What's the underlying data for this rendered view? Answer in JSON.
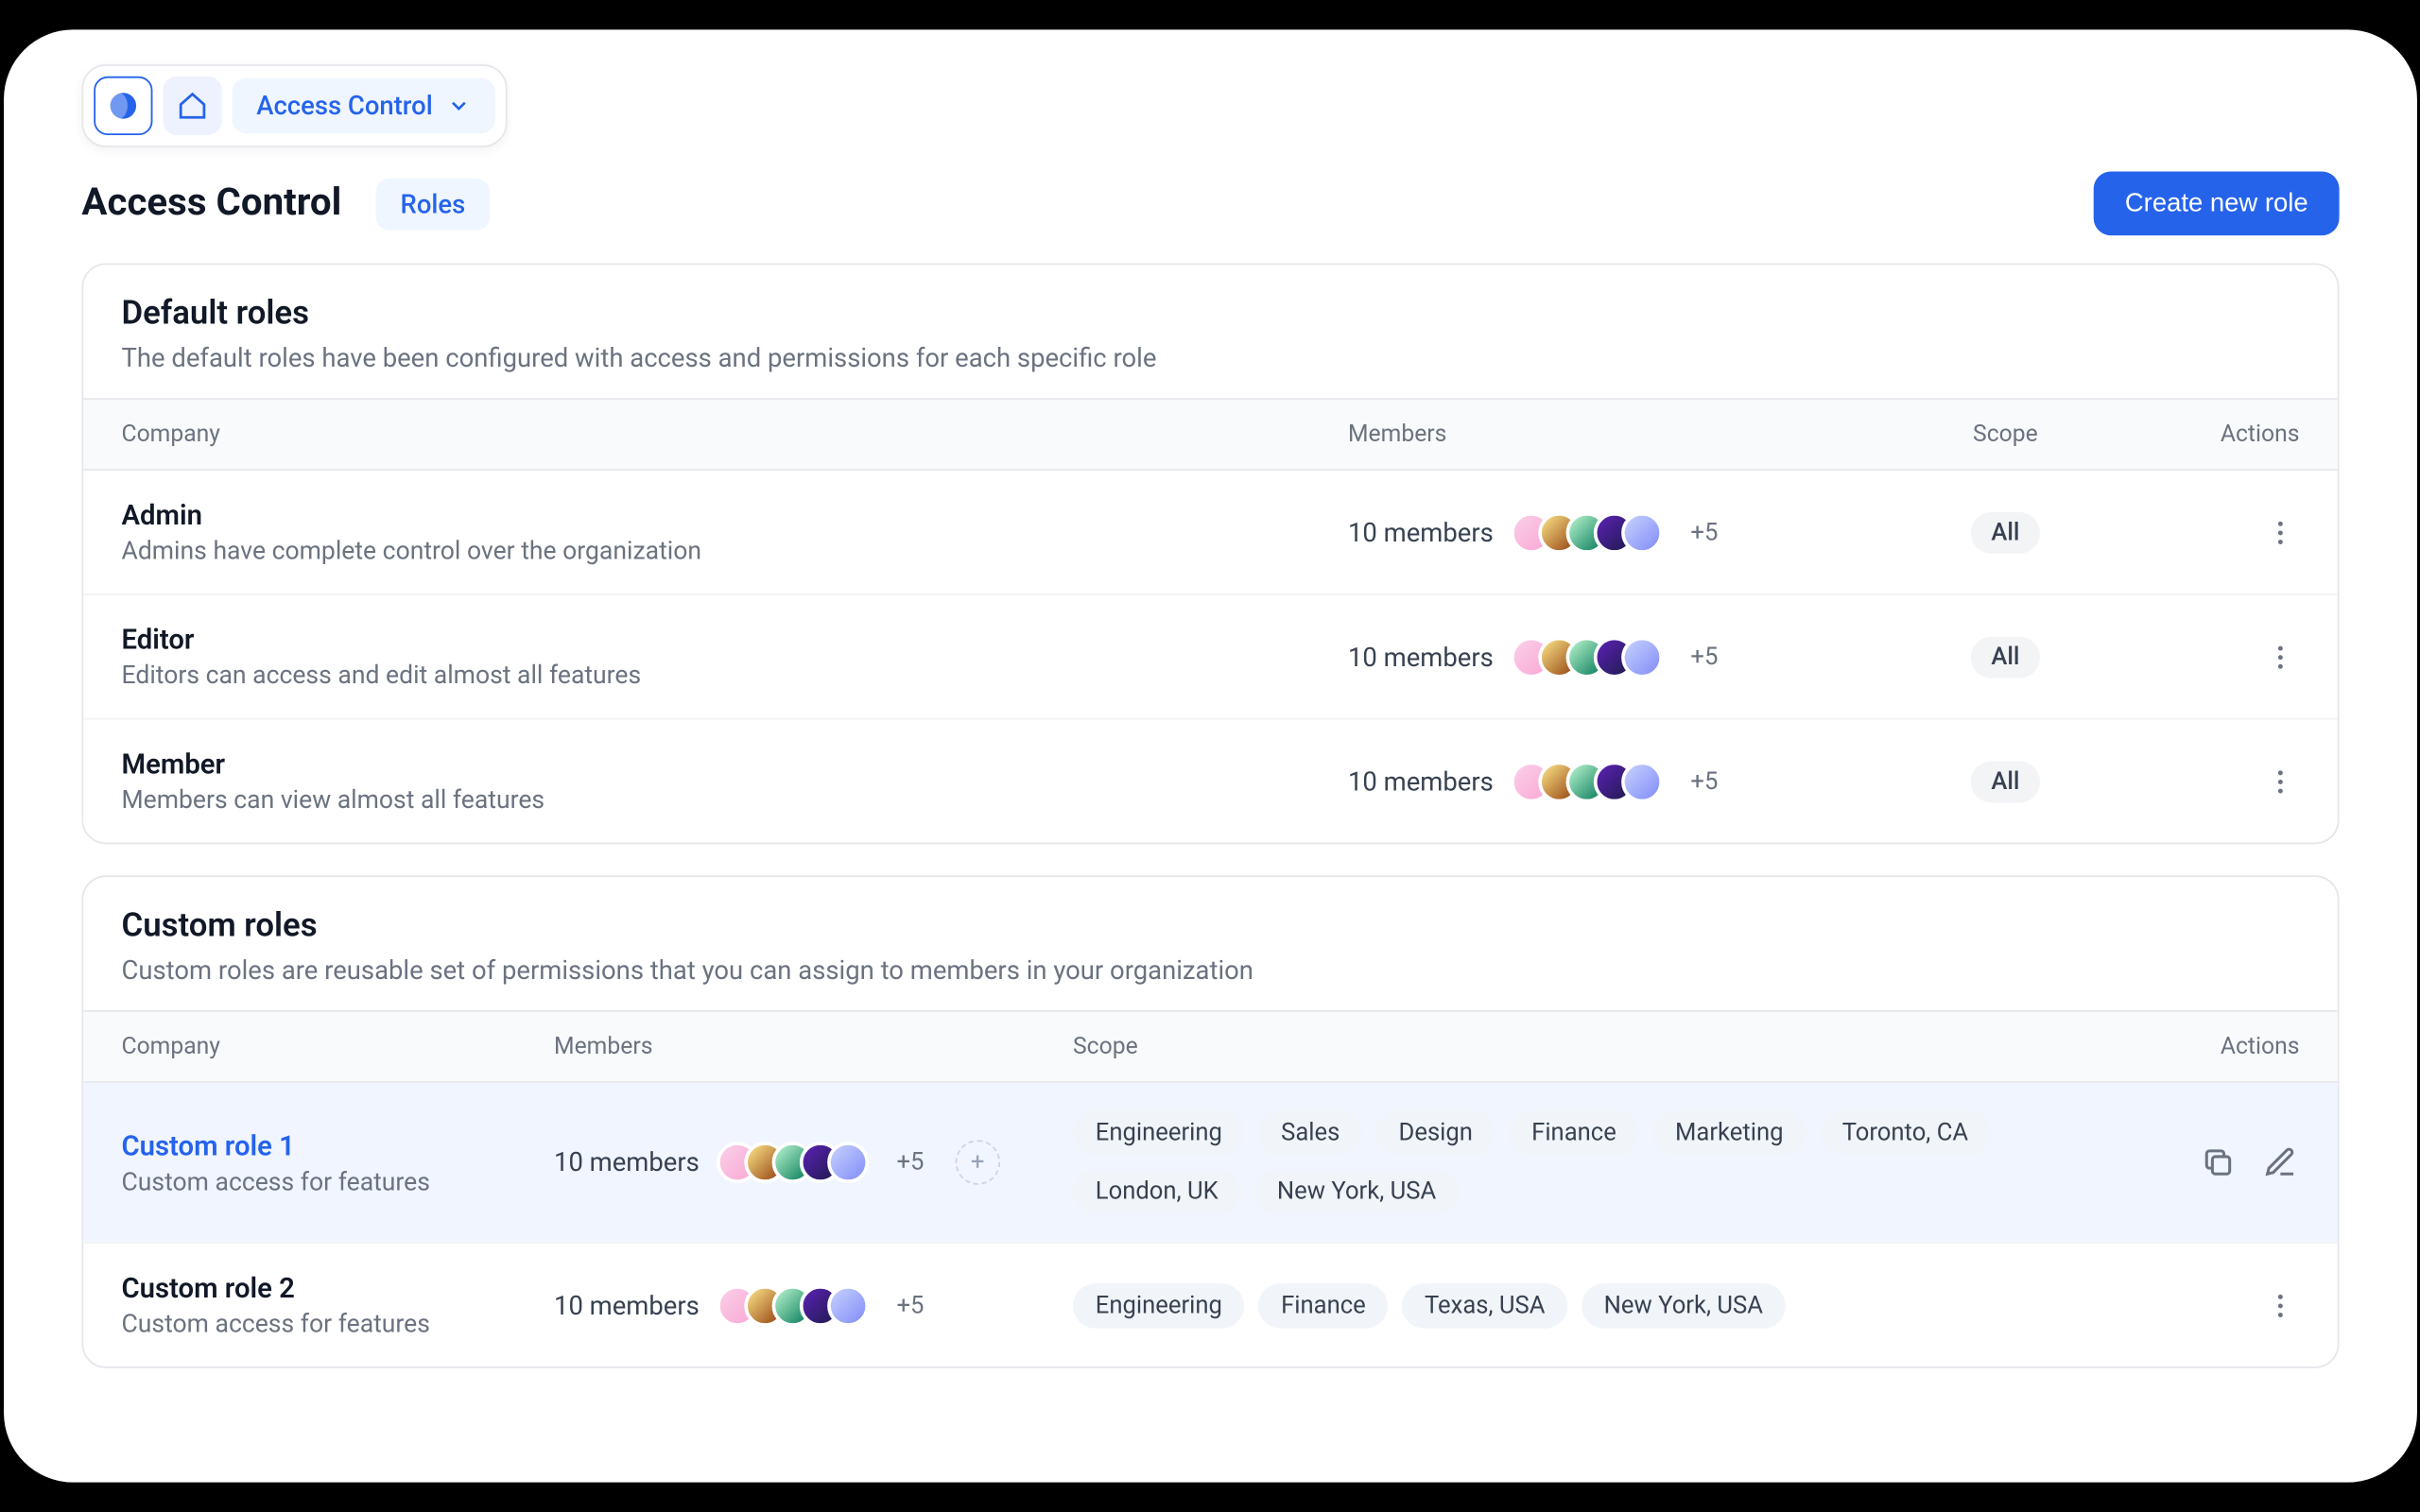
{
  "breadcrumb": {
    "label": "Access Control"
  },
  "header": {
    "title": "Access Control",
    "tab": "Roles",
    "create_btn": "Create new role"
  },
  "default_section": {
    "title": "Default roles",
    "subtitle": "The default roles have been configured with access and permissions for each specific role",
    "columns": {
      "company": "Company",
      "members": "Members",
      "scope": "Scope",
      "actions": "Actions"
    },
    "rows": [
      {
        "name": "Admin",
        "desc": "Admins have complete control over the organization",
        "members": "10 members",
        "overflow": "+5",
        "scope": "All"
      },
      {
        "name": "Editor",
        "desc": "Editors can access and edit almost all features",
        "members": "10 members",
        "overflow": "+5",
        "scope": "All"
      },
      {
        "name": "Member",
        "desc": "Members can view almost all features",
        "members": "10 members",
        "overflow": "+5",
        "scope": "All"
      }
    ]
  },
  "custom_section": {
    "title": "Custom roles",
    "subtitle": "Custom roles are reusable set of permissions that you can assign to members in your organization",
    "columns": {
      "company": "Company",
      "members": "Members",
      "scope": "Scope",
      "actions": "Actions"
    },
    "rows": [
      {
        "name": "Custom role 1",
        "desc": "Custom access for features",
        "members": "10 members",
        "overflow": "+5",
        "selected": true,
        "show_add": true,
        "tags": [
          "Engineering",
          "Sales",
          "Design",
          "Finance",
          "Marketing",
          "Toronto, CA",
          "London, UK",
          "New York, USA"
        ]
      },
      {
        "name": "Custom role 2",
        "desc": "Custom access for features",
        "members": "10 members",
        "overflow": "+5",
        "selected": false,
        "show_add": false,
        "tags": [
          "Engineering",
          "Finance",
          "Texas, USA",
          "New York, USA"
        ]
      }
    ]
  }
}
